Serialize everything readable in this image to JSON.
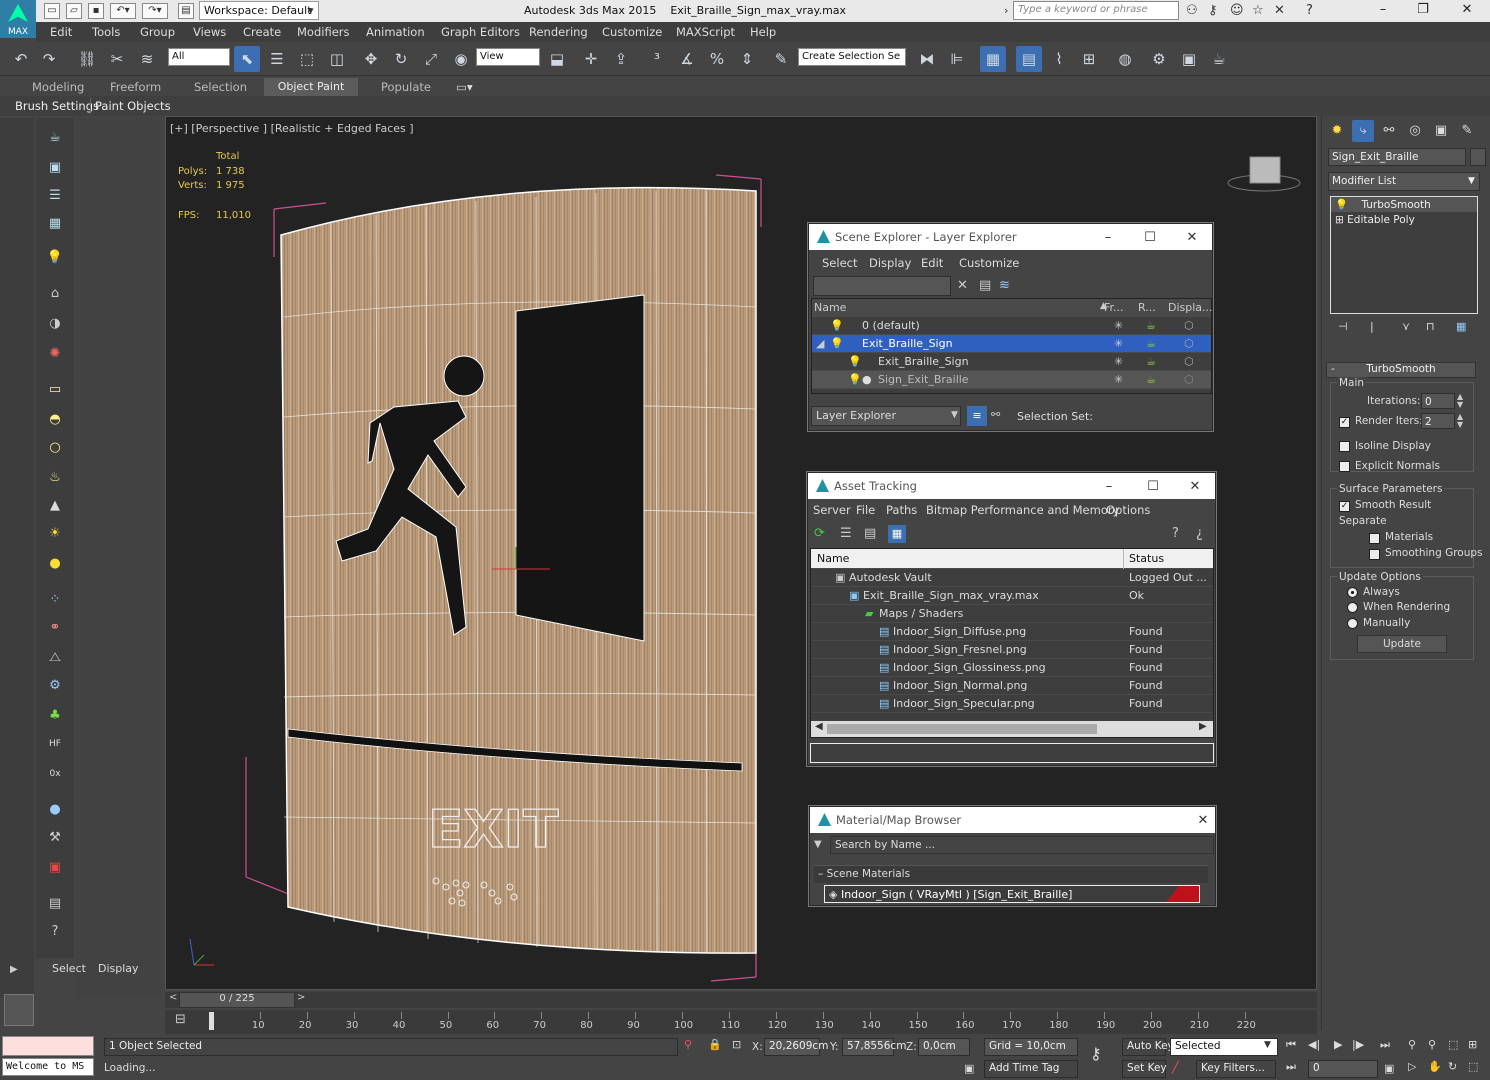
{
  "title": {
    "app": "Autodesk 3ds Max  2015",
    "file": "Exit_Braille_Sign_max_vray.max",
    "workspace": "Workspace: Default",
    "search_placeholder": "Type a keyword or phrase"
  },
  "logo_label": "MAX",
  "menu": [
    "Edit",
    "Tools",
    "Group",
    "Views",
    "Create",
    "Modifiers",
    "Animation",
    "Graph Editors",
    "Rendering",
    "Customize",
    "MAXScript",
    "Help"
  ],
  "toolbar": {
    "filter": "All",
    "ref_coord": "View",
    "selection_set": "Create Selection Se"
  },
  "ribbon": {
    "tabs": [
      "Modeling",
      "Freeform",
      "Selection",
      "Object Paint",
      "Populate"
    ],
    "subtabs": [
      "Brush Settings",
      "Paint Objects"
    ]
  },
  "viewport": {
    "label": "[+] [Perspective ] [Realistic + Edged Faces ]",
    "stats": {
      "total_label": "Total",
      "polys_label": "Polys:",
      "polys": "1 738",
      "verts_label": "Verts:",
      "verts": "1 975",
      "fps_label": "FPS:",
      "fps": "11,010"
    },
    "sign_text": "EXIT"
  },
  "left_panel": {
    "select": "Select",
    "display": "Display"
  },
  "scene_explorer": {
    "title": "Scene Explorer - Layer Explorer",
    "menu": [
      "Select",
      "Display",
      "Edit",
      "Customize"
    ],
    "columns": [
      "Name",
      "Fr...",
      "R...",
      "Displa..."
    ],
    "rows": [
      "0 (default)",
      "Exit_Braille_Sign",
      "Exit_Braille_Sign",
      "Sign_Exit_Braille"
    ],
    "footer_dropdown": "Layer Explorer",
    "footer_label": "Selection Set:"
  },
  "asset_tracking": {
    "title": "Asset Tracking",
    "menu": [
      "Server",
      "File",
      "Paths",
      "Bitmap Performance and Memory",
      "Options"
    ],
    "columns": [
      "Name",
      "Status"
    ],
    "rows": [
      {
        "name": "Autodesk Vault",
        "status": "Logged Out ..."
      },
      {
        "name": "Exit_Braille_Sign_max_vray.max",
        "status": "Ok"
      },
      {
        "name": "Maps / Shaders",
        "status": ""
      },
      {
        "name": "Indoor_Sign_Diffuse.png",
        "status": "Found"
      },
      {
        "name": "Indoor_Sign_Fresnel.png",
        "status": "Found"
      },
      {
        "name": "Indoor_Sign_Glossiness.png",
        "status": "Found"
      },
      {
        "name": "Indoor_Sign_Normal.png",
        "status": "Found"
      },
      {
        "name": "Indoor_Sign_Specular.png",
        "status": "Found"
      }
    ]
  },
  "material_browser": {
    "title": "Material/Map Browser",
    "search_placeholder": "Search by Name ...",
    "group": "Scene Materials",
    "item": "Indoor_Sign  ( VRayMtl )  [Sign_Exit_Braille]",
    "accent": "#c0111b"
  },
  "command_panel": {
    "object_name": "Sign_Exit_Braille",
    "modifier_list": "Modifier List",
    "stack": [
      "TurboSmooth",
      "Editable Poly"
    ],
    "rollout": "TurboSmooth",
    "main": "Main",
    "iterations_label": "Iterations:",
    "iterations": "0",
    "render_iters_label": "Render Iters:",
    "render_iters": "2",
    "isoline": "Isoline Display",
    "explicit_normals": "Explicit Normals",
    "surface_params": "Surface Parameters",
    "smooth_result": "Smooth Result",
    "separate": "Separate",
    "materials": "Materials",
    "smoothing_groups": "Smoothing Groups",
    "update_options": "Update Options",
    "always": "Always",
    "when_rendering": "When Rendering",
    "manually": "Manually",
    "update_button": "Update"
  },
  "timeline": {
    "frame": "0 / 225",
    "ticks": [
      "10",
      "20",
      "30",
      "40",
      "50",
      "60",
      "70",
      "80",
      "90",
      "100",
      "110",
      "120",
      "130",
      "140",
      "150",
      "160",
      "170",
      "180",
      "190",
      "200",
      "210",
      "220"
    ]
  },
  "status": {
    "maxscript": "Welcome to MS",
    "selection": "1 Object Selected",
    "prompt": "Loading...",
    "x_label": "X:",
    "x": "20,2609cm",
    "y_label": "Y:",
    "y": "57,8556cm",
    "z_label": "Z:",
    "z": "0,0cm",
    "grid": "Grid = 10,0cm",
    "add_time_tag": "Add Time Tag",
    "auto_key": "Auto Key",
    "set_key": "Set Key",
    "selected": "Selected",
    "key_filters": "Key Filters...",
    "frame_field": "0"
  },
  "colors": {
    "accent_blue": "#3b6fb1",
    "selection_highlight": "#2f5fbf",
    "wood": "#b89a7a",
    "frame_pink": "#d04f93"
  }
}
